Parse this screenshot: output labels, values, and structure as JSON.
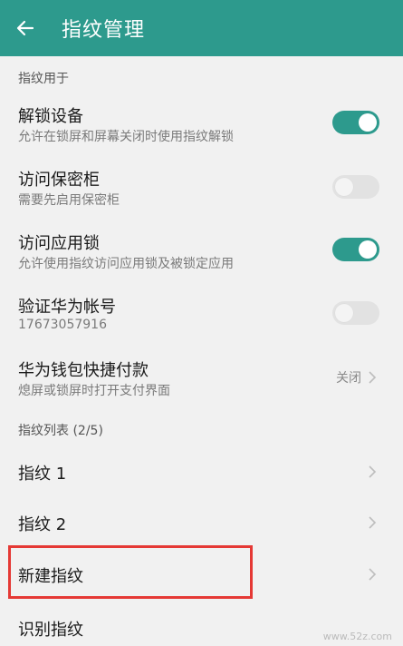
{
  "header": {
    "title": "指纹管理",
    "back_icon": "arrow-left-icon"
  },
  "section_usage": {
    "label": "指纹用于"
  },
  "settings": [
    {
      "title": "解锁设备",
      "subtitle": "允许在锁屏和屏幕关闭时使用指纹解锁",
      "toggle": "on"
    },
    {
      "title": "访问保密柜",
      "subtitle": "需要先启用保密柜",
      "toggle": "off"
    },
    {
      "title": "访问应用锁",
      "subtitle": "允许使用指纹访问应用锁及被锁定应用",
      "toggle": "on"
    },
    {
      "title": "验证华为帐号",
      "subtitle": "17673057916",
      "toggle": "off"
    },
    {
      "title": "华为钱包快捷付款",
      "subtitle": "熄屏或锁屏时打开支付界面",
      "value": "关闭"
    }
  ],
  "section_list": {
    "label": "指纹列表 (2/5)"
  },
  "fingerprints": [
    {
      "label": "指纹 1"
    },
    {
      "label": "指纹 2"
    },
    {
      "label": "新建指纹"
    },
    {
      "label": "识别指纹"
    }
  ],
  "watermark": "www.52z.com",
  "colors": {
    "accent": "#2d9a8d",
    "highlight": "#e53935"
  }
}
